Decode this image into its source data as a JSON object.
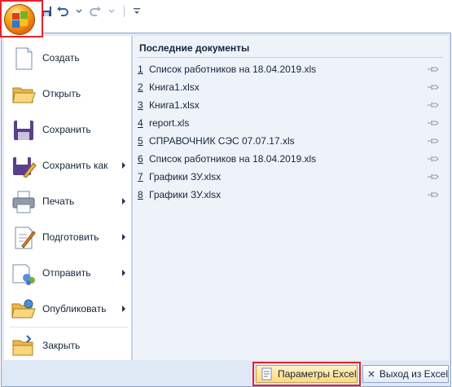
{
  "menu": {
    "commands": [
      {
        "label": "Создать",
        "icon": "new-document-icon",
        "submenu": false
      },
      {
        "label": "Открыть",
        "icon": "open-folder-icon",
        "submenu": false
      },
      {
        "label": "Сохранить",
        "icon": "save-disk-icon",
        "submenu": false
      },
      {
        "label": "Сохранить как",
        "icon": "save-as-icon",
        "submenu": true
      },
      {
        "label": "Печать",
        "icon": "printer-icon",
        "submenu": true
      },
      {
        "label": "Подготовить",
        "icon": "prepare-icon",
        "submenu": true
      },
      {
        "label": "Отправить",
        "icon": "send-icon",
        "submenu": true
      },
      {
        "label": "Опубликовать",
        "icon": "publish-icon",
        "submenu": true
      },
      {
        "label": "Закрыть",
        "icon": "close-folder-icon",
        "submenu": false
      }
    ]
  },
  "recent": {
    "title": "Последние документы",
    "documents": [
      {
        "num": "1",
        "name": "Список работников на 18.04.2019.xls"
      },
      {
        "num": "2",
        "name": "Книга1.xlsx"
      },
      {
        "num": "3",
        "name": "Книга1.xlsx"
      },
      {
        "num": "4",
        "name": "report.xls"
      },
      {
        "num": "5",
        "name": "СПРАВОЧНИК СЭС 07.07.17.xls"
      },
      {
        "num": "6",
        "name": "Список работников на 18.04.2019.xls"
      },
      {
        "num": "7",
        "name": "Графики ЗУ.xlsx"
      },
      {
        "num": "8",
        "name": "Графики ЗУ.xlsx"
      }
    ]
  },
  "footer": {
    "options_label": "Параметры Excel",
    "exit_label": "Выход из Excel"
  },
  "colors": {
    "highlight_frame": "#e8202a",
    "office_button": "#f8a91c"
  }
}
